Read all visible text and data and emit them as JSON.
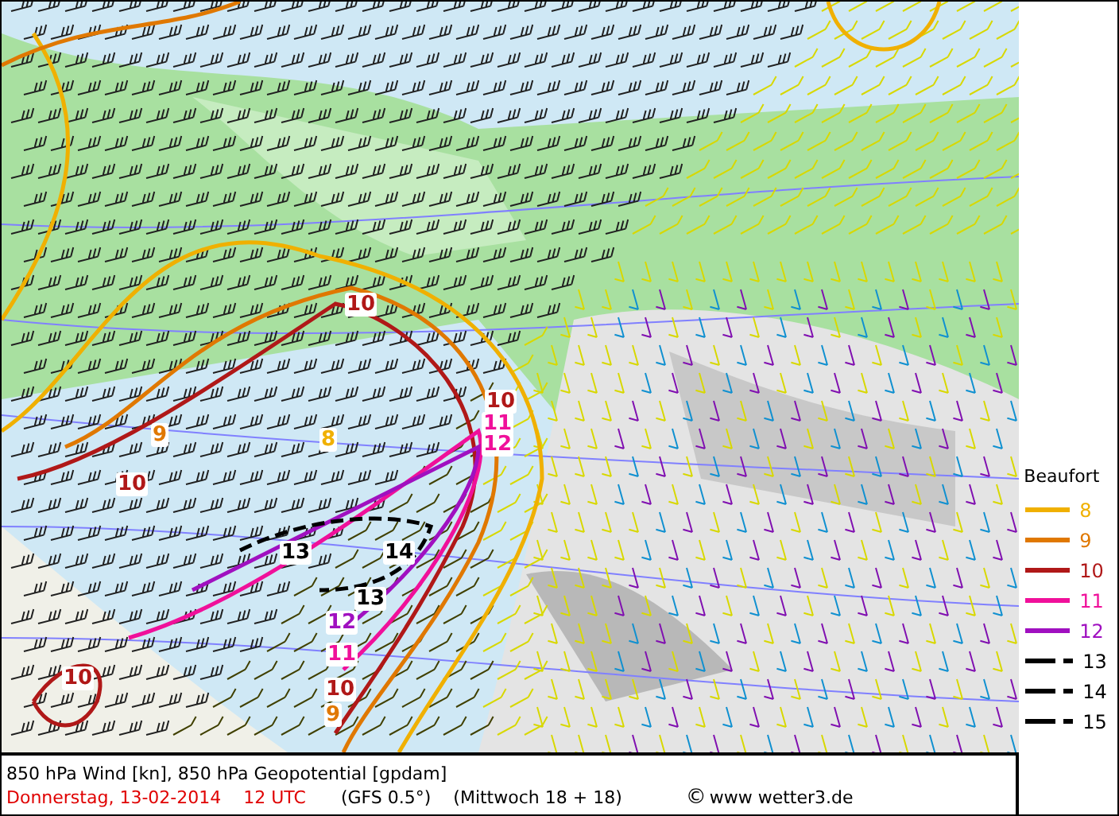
{
  "map": {
    "contour_labels": [
      {
        "text": "10",
        "color": "#b01818"
      },
      {
        "text": "9",
        "color": "#e07800"
      },
      {
        "text": "8",
        "color": "#f0b000"
      },
      {
        "text": "10",
        "color": "#b01818"
      },
      {
        "text": "11",
        "color": "#f0109a"
      },
      {
        "text": "12",
        "color": "#f0109a"
      },
      {
        "text": "10",
        "color": "#b01818"
      },
      {
        "text": "13",
        "color": "#000000"
      },
      {
        "text": "14",
        "color": "#000000"
      },
      {
        "text": "13",
        "color": "#000000"
      },
      {
        "text": "12",
        "color": "#a010c0"
      },
      {
        "text": "11",
        "color": "#f0109a"
      },
      {
        "text": "10",
        "color": "#b01818"
      },
      {
        "text": "9",
        "color": "#e07800"
      },
      {
        "text": "10",
        "color": "#b01818"
      }
    ]
  },
  "legend": {
    "title": "Beaufort",
    "items": [
      {
        "label": "8",
        "color": "#f0b000",
        "kind": "solid"
      },
      {
        "label": "9",
        "color": "#e07800",
        "kind": "solid"
      },
      {
        "label": "10",
        "color": "#b01818",
        "kind": "solid"
      },
      {
        "label": "11",
        "color": "#f0109a",
        "kind": "solid"
      },
      {
        "label": "12",
        "color": "#a010c0",
        "kind": "solid"
      },
      {
        "label": "13",
        "color": "#000000",
        "kind": "dashed"
      },
      {
        "label": "14",
        "color": "#000000",
        "kind": "dashed"
      },
      {
        "label": "15",
        "color": "#000000",
        "kind": "dashed"
      }
    ]
  },
  "caption": {
    "title": "850 hPa Wind [kn], 850 hPa Geopotential [gpdam]",
    "date": "Donnerstag, 13-02-2014",
    "time": "12 UTC",
    "model": "(GFS 0.5°)",
    "run": "(Mittwoch 18 + 18)",
    "copyright_mark": "©",
    "site": "www wetter3.de"
  }
}
